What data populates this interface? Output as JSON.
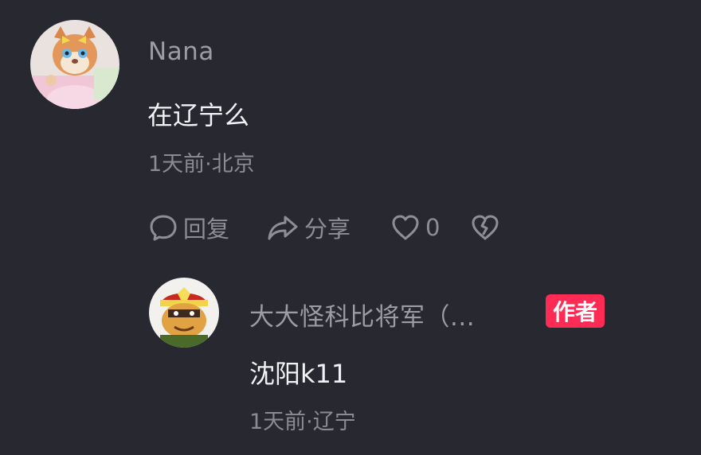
{
  "main_comment": {
    "username": "Nana",
    "text": "在辽宁么",
    "meta": "1天前·北京",
    "avatar_icon": "avatar-cartoon-fox-image",
    "actions": {
      "reply_label": "回复",
      "share_label": "分享",
      "like_count": "0"
    },
    "icons": [
      "comment-bubble-icon",
      "share-arrow-icon",
      "heart-icon",
      "broken-heart-icon"
    ]
  },
  "reply": {
    "username": "大大怪科比将军（...",
    "author_badge": "作者",
    "text": "沈阳k11",
    "meta": "1天前·辽宁",
    "avatar_icon": "avatar-cartoon-general-image"
  },
  "colors": {
    "background": "#272830",
    "username": "#9c9ca3",
    "text": "#f2f2f4",
    "meta": "#8b8c93",
    "badge": "#fe2c55"
  }
}
